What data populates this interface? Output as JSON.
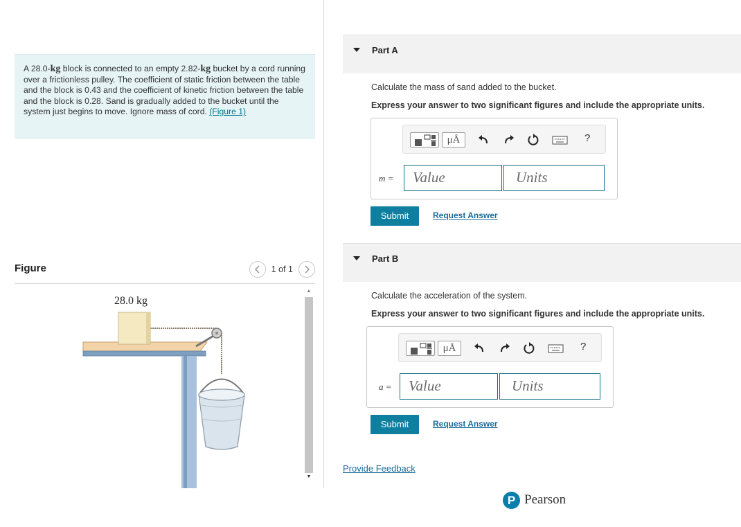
{
  "problem": {
    "part1": "A 28.0-",
    "unit1": "kg",
    "part2": " block is connected to an empty 2.82-",
    "unit2": "kg",
    "part3": " bucket by a cord running over a frictionless pulley. The coefficient of static friction between the table and the block is 0.43 and the coefficient of kinetic friction between the table and the block is 0.28. Sand is gradually added to the bucket until the system just begins to move. Ignore mass of cord. ",
    "figure_link": "(Figure 1)"
  },
  "figure": {
    "label": "Figure",
    "pager_text": "1 of 1",
    "prev_icon": "chevron-left-icon",
    "next_icon": "chevron-right-icon",
    "block_label": "28.0 kg"
  },
  "toolbar": {
    "units_symbol": "μÅ",
    "help": "?",
    "icons": [
      "fraction-template-icon",
      "units-icon",
      "undo-icon",
      "redo-icon",
      "reset-icon",
      "keyboard-icon",
      "help-icon"
    ]
  },
  "parts": [
    {
      "title": "Part A",
      "question": "Calculate the mass of sand added to the bucket.",
      "instruction": "Express your answer to two significant figures and include the appropriate units.",
      "variable": "m =",
      "value_placeholder": "Value",
      "units_placeholder": "Units",
      "submit": "Submit",
      "request": "Request Answer"
    },
    {
      "title": "Part B",
      "question": "Calculate the acceleration of the system.",
      "instruction": "Express your answer to two significant figures and include the appropriate units.",
      "variable": "a =",
      "value_placeholder": "Value",
      "units_placeholder": "Units",
      "submit": "Submit",
      "request": "Request Answer"
    }
  ],
  "feedback": "Provide Feedback",
  "brand": {
    "logo_letter": "P",
    "name": "Pearson",
    "color": "#0b7fab"
  },
  "colors": {
    "accent": "#0f7fa0",
    "link": "#1b6d9c",
    "problem_bg": "#e6f4f5"
  }
}
